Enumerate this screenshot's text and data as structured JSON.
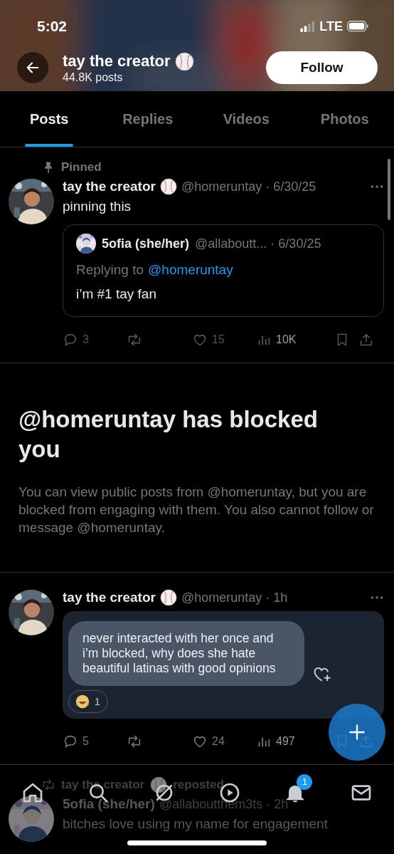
{
  "status_bar": {
    "time": "5:02",
    "network": "LTE"
  },
  "header": {
    "name": "tay the creator",
    "posts": "44.8K posts",
    "follow": "Follow"
  },
  "tabs": [
    {
      "label": "Posts",
      "selected": true
    },
    {
      "label": "Replies",
      "selected": false
    },
    {
      "label": "Videos",
      "selected": false
    },
    {
      "label": "Photos",
      "selected": false
    }
  ],
  "pinned_post": {
    "pinned_label": "Pinned",
    "name": "tay the creator",
    "meta": "@homeruntay · 6/30/25",
    "text": "pinning this",
    "quote": {
      "name": "5ofia (she/her)",
      "meta": "@allaboutt... · 6/30/25",
      "replying": "Replying to",
      "reply_handle": "@homeruntay",
      "text": "i’m #1 tay fan"
    },
    "stats": [
      {
        "kind": "reply",
        "count": "3"
      },
      {
        "kind": "repost"
      },
      {
        "kind": "like",
        "count": "15"
      },
      {
        "kind": "views",
        "count": "10K"
      },
      {
        "kind": "bookmark"
      },
      {
        "kind": "share"
      }
    ]
  },
  "blocked_notice": {
    "title": "@homeruntay has blocked you",
    "body": "You can view public posts from @homeruntay, but you are blocked from engaging with them. You also cannot follow or message @homeruntay."
  },
  "message_post": {
    "name": "tay the creator",
    "meta": "@homeruntay · 1h",
    "message": "never interacted with her once and i’m blocked, why does she hate beautiful latinas with good opinions",
    "reaction_count": "1",
    "stats": [
      {
        "kind": "reply",
        "count": "5"
      },
      {
        "kind": "repost"
      },
      {
        "kind": "like",
        "count": "24"
      },
      {
        "kind": "views",
        "count": "497"
      },
      {
        "kind": "bookmark"
      },
      {
        "kind": "share"
      }
    ]
  },
  "repost": {
    "reposter": "tay the creator",
    "label": "reposted",
    "name": "5ofia (she/her)",
    "meta": "@allaboutthem3ts · 2h",
    "text": "bitches love using my name for engagement"
  },
  "nav": [
    {
      "kind": "home"
    },
    {
      "kind": "search"
    },
    {
      "kind": "grok"
    },
    {
      "kind": "video"
    },
    {
      "kind": "notifications",
      "badge": "1"
    },
    {
      "kind": "messages"
    }
  ]
}
